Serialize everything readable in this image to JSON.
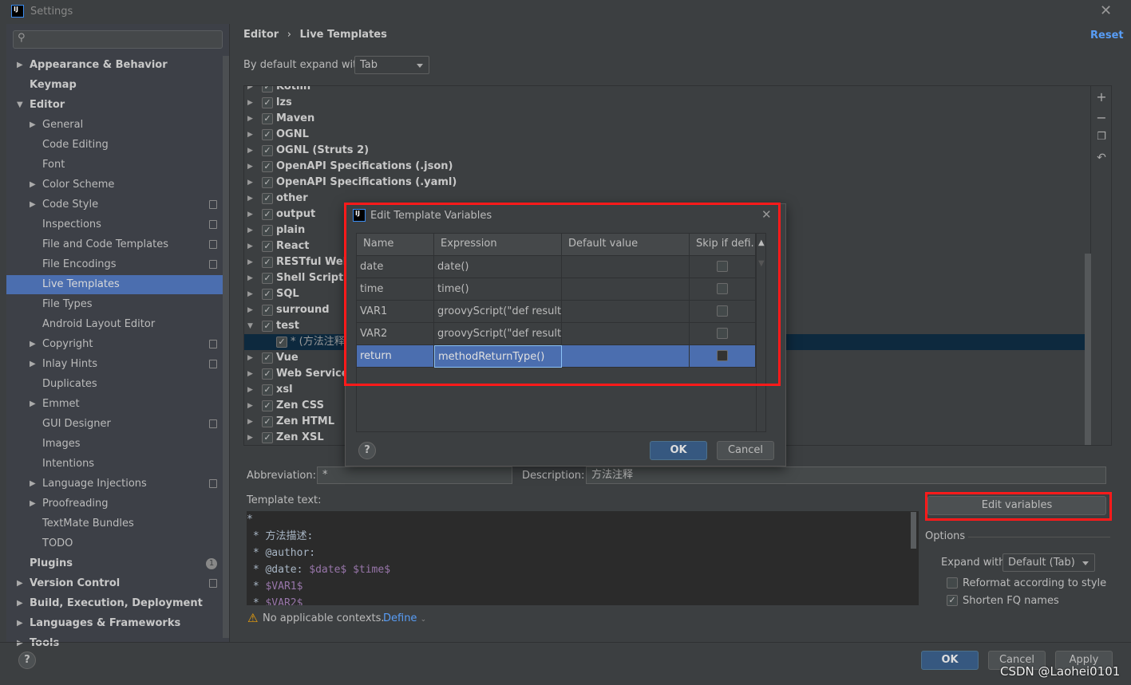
{
  "window": {
    "title": "Settings",
    "close_icon": "close-icon"
  },
  "sidebar": {
    "search_placeholder": "",
    "items": [
      {
        "label": "Appearance & Behavior",
        "level": 0,
        "arrow": "right",
        "bold": true
      },
      {
        "label": "Keymap",
        "level": 0,
        "bold": true
      },
      {
        "label": "Editor",
        "level": 0,
        "arrow": "down",
        "bold": true
      },
      {
        "label": "General",
        "level": 1,
        "arrow": "right"
      },
      {
        "label": "Code Editing",
        "level": 1
      },
      {
        "label": "Font",
        "level": 1
      },
      {
        "label": "Color Scheme",
        "level": 1,
        "arrow": "right"
      },
      {
        "label": "Code Style",
        "level": 1,
        "arrow": "right",
        "copy": true
      },
      {
        "label": "Inspections",
        "level": 1,
        "copy": true
      },
      {
        "label": "File and Code Templates",
        "level": 1,
        "copy": true
      },
      {
        "label": "File Encodings",
        "level": 1,
        "copy": true
      },
      {
        "label": "Live Templates",
        "level": 1,
        "selected": true
      },
      {
        "label": "File Types",
        "level": 1
      },
      {
        "label": "Android Layout Editor",
        "level": 1
      },
      {
        "label": "Copyright",
        "level": 1,
        "arrow": "right",
        "copy": true
      },
      {
        "label": "Inlay Hints",
        "level": 1,
        "arrow": "right",
        "copy": true
      },
      {
        "label": "Duplicates",
        "level": 1
      },
      {
        "label": "Emmet",
        "level": 1,
        "arrow": "right"
      },
      {
        "label": "GUI Designer",
        "level": 1,
        "copy": true
      },
      {
        "label": "Images",
        "level": 1
      },
      {
        "label": "Intentions",
        "level": 1
      },
      {
        "label": "Language Injections",
        "level": 1,
        "arrow": "right",
        "copy": true
      },
      {
        "label": "Proofreading",
        "level": 1,
        "arrow": "right"
      },
      {
        "label": "TextMate Bundles",
        "level": 1
      },
      {
        "label": "TODO",
        "level": 1
      },
      {
        "label": "Plugins",
        "level": 0,
        "bold": true,
        "badge": "1"
      },
      {
        "label": "Version Control",
        "level": 0,
        "arrow": "right",
        "bold": true,
        "copy": true
      },
      {
        "label": "Build, Execution, Deployment",
        "level": 0,
        "arrow": "right",
        "bold": true
      },
      {
        "label": "Languages & Frameworks",
        "level": 0,
        "arrow": "right",
        "bold": true
      },
      {
        "label": "Tools",
        "level": 0,
        "arrow": "right",
        "bold": true
      }
    ]
  },
  "header": {
    "breadcrumb": [
      "Editor",
      "Live Templates"
    ],
    "separator": "›",
    "reset": "Reset"
  },
  "expand": {
    "label": "By default expand with",
    "value": "Tab"
  },
  "templates": [
    {
      "label": "Kotlin",
      "checked": true,
      "arrow": "right"
    },
    {
      "label": "lzs",
      "checked": true,
      "arrow": "right"
    },
    {
      "label": "Maven",
      "checked": true,
      "arrow": "right"
    },
    {
      "label": "OGNL",
      "checked": true,
      "arrow": "right"
    },
    {
      "label": "OGNL (Struts 2)",
      "checked": true,
      "arrow": "right"
    },
    {
      "label": "OpenAPI Specifications (.json)",
      "checked": true,
      "arrow": "right"
    },
    {
      "label": "OpenAPI Specifications (.yaml)",
      "checked": true,
      "arrow": "right"
    },
    {
      "label": "other",
      "checked": true,
      "arrow": "right"
    },
    {
      "label": "output",
      "checked": true,
      "arrow": "right"
    },
    {
      "label": "plain",
      "checked": true,
      "arrow": "right"
    },
    {
      "label": "React",
      "checked": true,
      "arrow": "right"
    },
    {
      "label": "RESTful Web Services",
      "checked": true,
      "arrow": "right"
    },
    {
      "label": "Shell Script",
      "checked": true,
      "arrow": "right"
    },
    {
      "label": "SQL",
      "checked": true,
      "arrow": "right"
    },
    {
      "label": "surround",
      "checked": true,
      "arrow": "right"
    },
    {
      "label": "test",
      "checked": true,
      "arrow": "down"
    },
    {
      "label": "* (方法注释)",
      "checked": true,
      "child": true,
      "selected": true
    },
    {
      "label": "Vue",
      "checked": true,
      "arrow": "right"
    },
    {
      "label": "Web Services",
      "checked": true,
      "arrow": "right"
    },
    {
      "label": "xsl",
      "checked": true,
      "arrow": "right"
    },
    {
      "label": "Zen CSS",
      "checked": true,
      "arrow": "right"
    },
    {
      "label": "Zen HTML",
      "checked": true,
      "arrow": "right"
    },
    {
      "label": "Zen XSL",
      "checked": true,
      "arrow": "right"
    }
  ],
  "tree_tools": [
    "plus-icon",
    "minus-icon",
    "copy-icon",
    "undo-icon"
  ],
  "details": {
    "abbreviation_label": "Abbreviation:",
    "abbreviation": "*",
    "description_label": "Description:",
    "description": "方法注释",
    "template_text_label": "Template text:",
    "template_lines": [
      [
        {
          "t": "*"
        }
      ],
      [
        {
          "t": " * 方法描述:"
        }
      ],
      [
        {
          "t": " * @author:"
        }
      ],
      [
        {
          "t": " * @date: "
        },
        {
          "t": "$date$",
          "v": true
        },
        {
          "t": " "
        },
        {
          "t": "$time$",
          "v": true
        }
      ],
      [
        {
          "t": " * "
        },
        {
          "t": "$VAR1$",
          "v": true
        }
      ],
      [
        {
          "t": " * "
        },
        {
          "t": "$VAR2$",
          "v": true
        }
      ]
    ],
    "warning": "No applicable contexts.",
    "define": "Define",
    "edit_variables": "Edit variables",
    "options_label": "Options",
    "expand_with_label": "Expand with",
    "expand_with_value": "Default (Tab)",
    "reformat_label": "Reformat according to style",
    "reformat_checked": false,
    "shorten_label": "Shorten FQ names",
    "shorten_checked": true
  },
  "dialog": {
    "title": "Edit Template Variables",
    "columns": [
      "Name",
      "Expression",
      "Default value",
      "Skip if defi..."
    ],
    "rows": [
      {
        "name": "date",
        "expression": "date()",
        "default": "",
        "skip": false
      },
      {
        "name": "time",
        "expression": "time()",
        "default": "",
        "skip": false
      },
      {
        "name": "VAR1",
        "expression": "groovyScript(\"def result...",
        "default": "",
        "skip": false
      },
      {
        "name": "VAR2",
        "expression": "groovyScript(\"def result...",
        "default": "",
        "skip": false
      },
      {
        "name": "return",
        "expression": "methodReturnType()",
        "default": "",
        "skip": false,
        "selected": true
      }
    ],
    "ok": "OK",
    "cancel": "Cancel",
    "help": "?"
  },
  "footer": {
    "ok": "OK",
    "cancel": "Cancel",
    "apply": "Apply",
    "help": "?"
  },
  "watermark": "CSDN @Laohei0101",
  "colors": {
    "accent": "#4b6eaf",
    "link": "#589df6",
    "highlight_box": "#ff1a1a",
    "primary_button": "#365880"
  }
}
